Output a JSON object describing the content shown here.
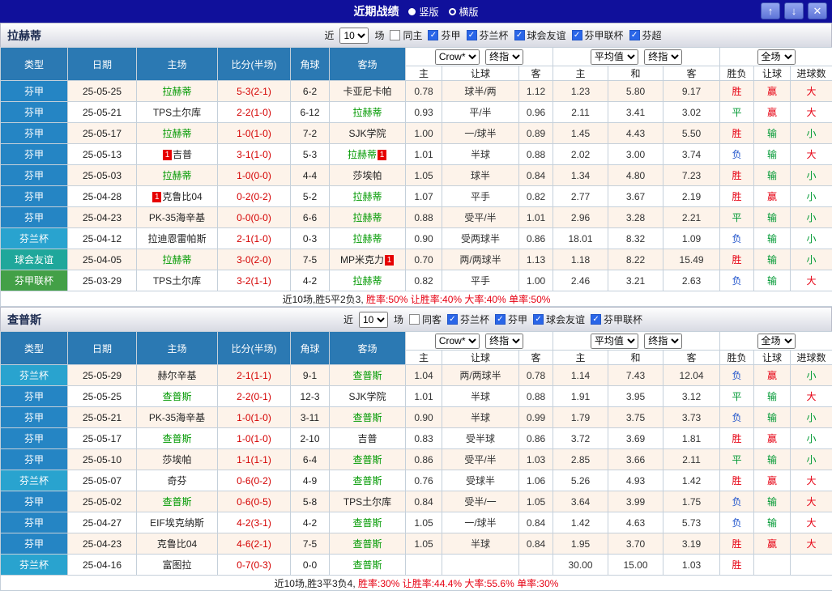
{
  "titlebar": {
    "title": "近期战绩",
    "vertical_label": "竖版",
    "horizontal_label": "横版",
    "selected": "竖版",
    "up_glyph": "↑",
    "down_glyph": "↓",
    "close_glyph": "✕"
  },
  "filter_labels": {
    "near": "近",
    "matches": "场"
  },
  "header": {
    "type": "类型",
    "date": "日期",
    "home": "主场",
    "score": "比分(半场)",
    "corner": "角球",
    "away": "客场",
    "book_select": "Crow*",
    "final_select": "终指",
    "avg_select": "平均值",
    "avg_final_select": "终指",
    "full_select": "全场",
    "sub_home": "主",
    "sub_line": "让球",
    "sub_away": "客",
    "sub_avg_home": "主",
    "sub_avg_draw": "和",
    "sub_avg_away": "客",
    "sub_result": "胜负",
    "sub_handicap": "让球",
    "sub_goals": "进球数"
  },
  "colors": {
    "titlebar_bg": "#10109b",
    "header_blue": "#2b79b3",
    "league": {
      "芬甲": "#2585c4",
      "芬兰杯": "#29a3cf",
      "球会友谊": "#1fa79b",
      "芬甲联杯": "#43a047",
      "芬超": "#2585c4"
    },
    "result": {
      "胜": "#e60012",
      "平": "#009933",
      "负": "#2255cc"
    },
    "handicap": {
      "赢": "#e60012",
      "输": "#009933"
    },
    "goals": {
      "大": "#e60012",
      "小": "#009933"
    },
    "focus_team": "#009900",
    "score": "#d40000",
    "alt_row": "#fdf3ea"
  },
  "sections": [
    {
      "team": "拉赫蒂",
      "filter": {
        "count": "10",
        "checkboxes": [
          {
            "label": "同主",
            "checked": false
          },
          {
            "label": "芬甲",
            "checked": true
          },
          {
            "label": "芬兰杯",
            "checked": true
          },
          {
            "label": "球会友谊",
            "checked": true
          },
          {
            "label": "芬甲联杯",
            "checked": true
          },
          {
            "label": "芬超",
            "checked": true
          }
        ]
      },
      "rows": [
        {
          "league": "芬甲",
          "date": "25-05-25",
          "home": "拉赫蒂",
          "home_focus": true,
          "home_card": "",
          "score": "5-3(2-1)",
          "corner": "6-2",
          "away": "卡亚尼卡帕",
          "away_focus": false,
          "away_card": "",
          "odds_home": "0.78",
          "odds_line": "球半/两",
          "odds_away": "1.12",
          "avg_home": "1.23",
          "avg_draw": "5.80",
          "avg_away": "9.17",
          "result": "胜",
          "handicap": "赢",
          "goals": "大"
        },
        {
          "league": "芬甲",
          "date": "25-05-21",
          "home": "TPS土尔库",
          "home_focus": false,
          "home_card": "",
          "score": "2-2(1-0)",
          "corner": "6-12",
          "away": "拉赫蒂",
          "away_focus": true,
          "away_card": "",
          "odds_home": "0.93",
          "odds_line": "平/半",
          "odds_away": "0.96",
          "avg_home": "2.11",
          "avg_draw": "3.41",
          "avg_away": "3.02",
          "result": "平",
          "handicap": "赢",
          "goals": "大"
        },
        {
          "league": "芬甲",
          "date": "25-05-17",
          "home": "拉赫蒂",
          "home_focus": true,
          "home_card": "",
          "score": "1-0(1-0)",
          "corner": "7-2",
          "away": "SJK学院",
          "away_focus": false,
          "away_card": "",
          "odds_home": "1.00",
          "odds_line": "一/球半",
          "odds_away": "0.89",
          "avg_home": "1.45",
          "avg_draw": "4.43",
          "avg_away": "5.50",
          "result": "胜",
          "handicap": "输",
          "goals": "小"
        },
        {
          "league": "芬甲",
          "date": "25-05-13",
          "home": "吉普",
          "home_focus": false,
          "home_card": "1",
          "score": "3-1(1-0)",
          "corner": "5-3",
          "away": "拉赫蒂",
          "away_focus": true,
          "away_card": "1",
          "odds_home": "1.01",
          "odds_line": "半球",
          "odds_away": "0.88",
          "avg_home": "2.02",
          "avg_draw": "3.00",
          "avg_away": "3.74",
          "result": "负",
          "handicap": "输",
          "goals": "大"
        },
        {
          "league": "芬甲",
          "date": "25-05-03",
          "home": "拉赫蒂",
          "home_focus": true,
          "home_card": "",
          "score": "1-0(0-0)",
          "corner": "4-4",
          "away": "莎埃帕",
          "away_focus": false,
          "away_card": "",
          "odds_home": "1.05",
          "odds_line": "球半",
          "odds_away": "0.84",
          "avg_home": "1.34",
          "avg_draw": "4.80",
          "avg_away": "7.23",
          "result": "胜",
          "handicap": "输",
          "goals": "小"
        },
        {
          "league": "芬甲",
          "date": "25-04-28",
          "home": "克鲁比04",
          "home_focus": false,
          "home_card": "1",
          "score": "0-2(0-2)",
          "corner": "5-2",
          "away": "拉赫蒂",
          "away_focus": true,
          "away_card": "",
          "odds_home": "1.07",
          "odds_line": "平手",
          "odds_away": "0.82",
          "avg_home": "2.77",
          "avg_draw": "3.67",
          "avg_away": "2.19",
          "result": "胜",
          "handicap": "赢",
          "goals": "小"
        },
        {
          "league": "芬甲",
          "date": "25-04-23",
          "home": "PK-35海辛基",
          "home_focus": false,
          "home_card": "",
          "score": "0-0(0-0)",
          "corner": "6-6",
          "away": "拉赫蒂",
          "away_focus": true,
          "away_card": "",
          "odds_home": "0.88",
          "odds_line": "受平/半",
          "odds_away": "1.01",
          "avg_home": "2.96",
          "avg_draw": "3.28",
          "avg_away": "2.21",
          "result": "平",
          "handicap": "输",
          "goals": "小"
        },
        {
          "league": "芬兰杯",
          "date": "25-04-12",
          "home": "拉迪恩雷帕斯",
          "home_focus": false,
          "home_card": "",
          "score": "2-1(1-0)",
          "corner": "0-3",
          "away": "拉赫蒂",
          "away_focus": true,
          "away_card": "",
          "odds_home": "0.90",
          "odds_line": "受两球半",
          "odds_away": "0.86",
          "avg_home": "18.01",
          "avg_draw": "8.32",
          "avg_away": "1.09",
          "result": "负",
          "handicap": "输",
          "goals": "小"
        },
        {
          "league": "球会友谊",
          "date": "25-04-05",
          "home": "拉赫蒂",
          "home_focus": true,
          "home_card": "",
          "score": "3-0(2-0)",
          "corner": "7-5",
          "away": "MP米克力",
          "away_focus": false,
          "away_card": "1",
          "odds_home": "0.70",
          "odds_line": "两/两球半",
          "odds_away": "1.13",
          "avg_home": "1.18",
          "avg_draw": "8.22",
          "avg_away": "15.49",
          "result": "胜",
          "handicap": "输",
          "goals": "小"
        },
        {
          "league": "芬甲联杯",
          "date": "25-03-29",
          "home": "TPS土尔库",
          "home_focus": false,
          "home_card": "",
          "score": "3-2(1-1)",
          "corner": "4-2",
          "away": "拉赫蒂",
          "away_focus": true,
          "away_card": "",
          "odds_home": "0.82",
          "odds_line": "平手",
          "odds_away": "1.00",
          "avg_home": "2.46",
          "avg_draw": "3.21",
          "avg_away": "2.63",
          "result": "负",
          "handicap": "输",
          "goals": "大"
        }
      ],
      "summary_prefix": "近10场,胜5平2负3,",
      "summary_stats": " 胜率:50% 让胜率:40% 大率:40% 单率:50%"
    },
    {
      "team": "查普斯",
      "filter": {
        "count": "10",
        "checkboxes": [
          {
            "label": "同客",
            "checked": false
          },
          {
            "label": "芬兰杯",
            "checked": true
          },
          {
            "label": "芬甲",
            "checked": true
          },
          {
            "label": "球会友谊",
            "checked": true
          },
          {
            "label": "芬甲联杯",
            "checked": true
          }
        ]
      },
      "rows": [
        {
          "league": "芬兰杯",
          "date": "25-05-29",
          "home": "赫尔辛基",
          "home_focus": false,
          "home_card": "",
          "score": "2-1(1-1)",
          "corner": "9-1",
          "away": "查普斯",
          "away_focus": true,
          "away_card": "",
          "odds_home": "1.04",
          "odds_line": "两/两球半",
          "odds_away": "0.78",
          "avg_home": "1.14",
          "avg_draw": "7.43",
          "avg_away": "12.04",
          "result": "负",
          "handicap": "赢",
          "goals": "小"
        },
        {
          "league": "芬甲",
          "date": "25-05-25",
          "home": "查普斯",
          "home_focus": true,
          "home_card": "",
          "score": "2-2(0-1)",
          "corner": "12-3",
          "away": "SJK学院",
          "away_focus": false,
          "away_card": "",
          "odds_home": "1.01",
          "odds_line": "半球",
          "odds_away": "0.88",
          "avg_home": "1.91",
          "avg_draw": "3.95",
          "avg_away": "3.12",
          "result": "平",
          "handicap": "输",
          "goals": "大"
        },
        {
          "league": "芬甲",
          "date": "25-05-21",
          "home": "PK-35海辛基",
          "home_focus": false,
          "home_card": "",
          "score": "1-0(1-0)",
          "corner": "3-11",
          "away": "查普斯",
          "away_focus": true,
          "away_card": "",
          "odds_home": "0.90",
          "odds_line": "半球",
          "odds_away": "0.99",
          "avg_home": "1.79",
          "avg_draw": "3.75",
          "avg_away": "3.73",
          "result": "负",
          "handicap": "输",
          "goals": "小"
        },
        {
          "league": "芬甲",
          "date": "25-05-17",
          "home": "查普斯",
          "home_focus": true,
          "home_card": "",
          "score": "1-0(1-0)",
          "corner": "2-10",
          "away": "吉普",
          "away_focus": false,
          "away_card": "",
          "odds_home": "0.83",
          "odds_line": "受半球",
          "odds_away": "0.86",
          "avg_home": "3.72",
          "avg_draw": "3.69",
          "avg_away": "1.81",
          "result": "胜",
          "handicap": "赢",
          "goals": "小"
        },
        {
          "league": "芬甲",
          "date": "25-05-10",
          "home": "莎埃帕",
          "home_focus": false,
          "home_card": "",
          "score": "1-1(1-1)",
          "corner": "6-4",
          "away": "查普斯",
          "away_focus": true,
          "away_card": "",
          "odds_home": "0.86",
          "odds_line": "受平/半",
          "odds_away": "1.03",
          "avg_home": "2.85",
          "avg_draw": "3.66",
          "avg_away": "2.11",
          "result": "平",
          "handicap": "输",
          "goals": "小"
        },
        {
          "league": "芬兰杯",
          "date": "25-05-07",
          "home": "奇芬",
          "home_focus": false,
          "home_card": "",
          "score": "0-6(0-2)",
          "corner": "4-9",
          "away": "查普斯",
          "away_focus": true,
          "away_card": "",
          "odds_home": "0.76",
          "odds_line": "受球半",
          "odds_away": "1.06",
          "avg_home": "5.26",
          "avg_draw": "4.93",
          "avg_away": "1.42",
          "result": "胜",
          "handicap": "赢",
          "goals": "大"
        },
        {
          "league": "芬甲",
          "date": "25-05-02",
          "home": "查普斯",
          "home_focus": true,
          "home_card": "",
          "score": "0-6(0-5)",
          "corner": "5-8",
          "away": "TPS土尔库",
          "away_focus": false,
          "away_card": "",
          "odds_home": "0.84",
          "odds_line": "受半/一",
          "odds_away": "1.05",
          "avg_home": "3.64",
          "avg_draw": "3.99",
          "avg_away": "1.75",
          "result": "负",
          "handicap": "输",
          "goals": "大"
        },
        {
          "league": "芬甲",
          "date": "25-04-27",
          "home": "EIF埃克纳斯",
          "home_focus": false,
          "home_card": "",
          "score": "4-2(3-1)",
          "corner": "4-2",
          "away": "查普斯",
          "away_focus": true,
          "away_card": "",
          "odds_home": "1.05",
          "odds_line": "一/球半",
          "odds_away": "0.84",
          "avg_home": "1.42",
          "avg_draw": "4.63",
          "avg_away": "5.73",
          "result": "负",
          "handicap": "输",
          "goals": "大"
        },
        {
          "league": "芬甲",
          "date": "25-04-23",
          "home": "克鲁比04",
          "home_focus": false,
          "home_card": "",
          "score": "4-6(2-1)",
          "corner": "7-5",
          "away": "查普斯",
          "away_focus": true,
          "away_card": "",
          "odds_home": "1.05",
          "odds_line": "半球",
          "odds_away": "0.84",
          "avg_home": "1.95",
          "avg_draw": "3.70",
          "avg_away": "3.19",
          "result": "胜",
          "handicap": "赢",
          "goals": "大"
        },
        {
          "league": "芬兰杯",
          "date": "25-04-16",
          "home": "富图拉",
          "home_focus": false,
          "home_card": "",
          "score": "0-7(0-3)",
          "corner": "0-0",
          "away": "查普斯",
          "away_focus": true,
          "away_card": "",
          "odds_home": "",
          "odds_line": "",
          "odds_away": "",
          "avg_home": "30.00",
          "avg_draw": "15.00",
          "avg_away": "1.03",
          "result": "胜",
          "handicap": "",
          "goals": ""
        }
      ],
      "summary_prefix": "近10场,胜3平3负4,",
      "summary_stats": " 胜率:30% 让胜率:44.4% 大率:55.6% 单率:30%"
    }
  ]
}
